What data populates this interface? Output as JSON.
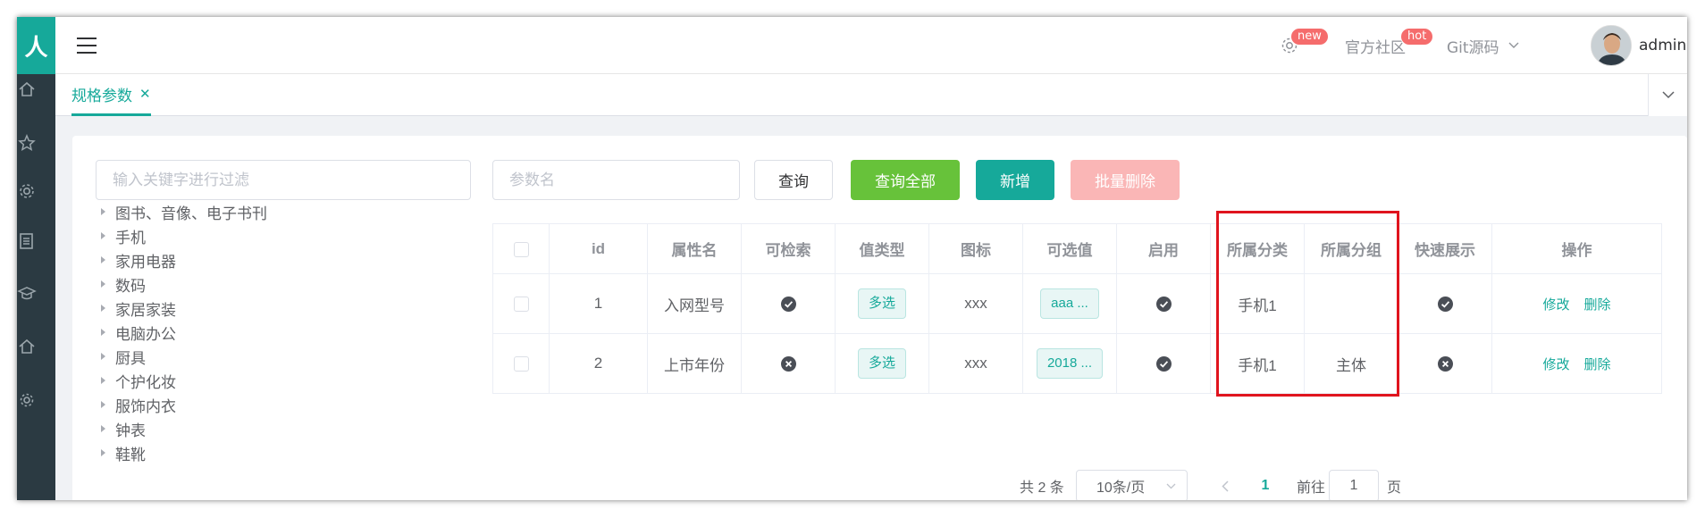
{
  "sidebar": {
    "logo_text": "人",
    "icons": [
      "home-icon",
      "star-icon",
      "gear-icon",
      "document-icon",
      "graduation-icon",
      "home-icon",
      "settings-icon"
    ]
  },
  "header": {
    "menu_icon": "hamburger-icon",
    "settings_badge": "new",
    "community_label": "官方社区",
    "community_badge": "hot",
    "git_label": "Git源码",
    "username": "admin"
  },
  "tabs": [
    {
      "label": "规格参数",
      "active": true
    }
  ],
  "filter": {
    "placeholder": "输入关键字进行过滤"
  },
  "tree": [
    "图书、音像、电子书刊",
    "手机",
    "家用电器",
    "数码",
    "家居家装",
    "电脑办公",
    "厨具",
    "个护化妆",
    "服饰内衣",
    "钟表",
    "鞋靴"
  ],
  "search": {
    "placeholder": "参数名",
    "query_label": "查询",
    "query_all_label": "查询全部",
    "add_label": "新增",
    "batch_delete_label": "批量删除"
  },
  "table": {
    "headers": [
      "id",
      "属性名",
      "可检索",
      "值类型",
      "图标",
      "可选值",
      "启用",
      "所属分类",
      "所属分组",
      "快速展示",
      "操作"
    ],
    "rows": [
      {
        "id": "1",
        "name": "入网型号",
        "searchable": true,
        "value_type": "多选",
        "icon": "xxx",
        "values": "aaa ...",
        "enabled": true,
        "category": "手机1",
        "group": "",
        "quick_show": true,
        "edit": "修改",
        "delete": "删除"
      },
      {
        "id": "2",
        "name": "上市年份",
        "searchable": false,
        "value_type": "多选",
        "icon": "xxx",
        "values": "2018 ...",
        "enabled": true,
        "category": "手机1",
        "group": "主体",
        "quick_show": false,
        "edit": "修改",
        "delete": "删除"
      }
    ]
  },
  "pagination": {
    "total_text": "共 2 条",
    "page_size": "10条/页",
    "current_page": "1",
    "goto_label": "前往",
    "goto_value": "1",
    "page_suffix": "页"
  },
  "colors": {
    "primary": "#16a99a",
    "success": "#67c23a",
    "danger_disabled": "#fab6b6",
    "badge": "#f56c6c",
    "highlight": "#e0141e",
    "sidebar": "#2b3a42"
  }
}
